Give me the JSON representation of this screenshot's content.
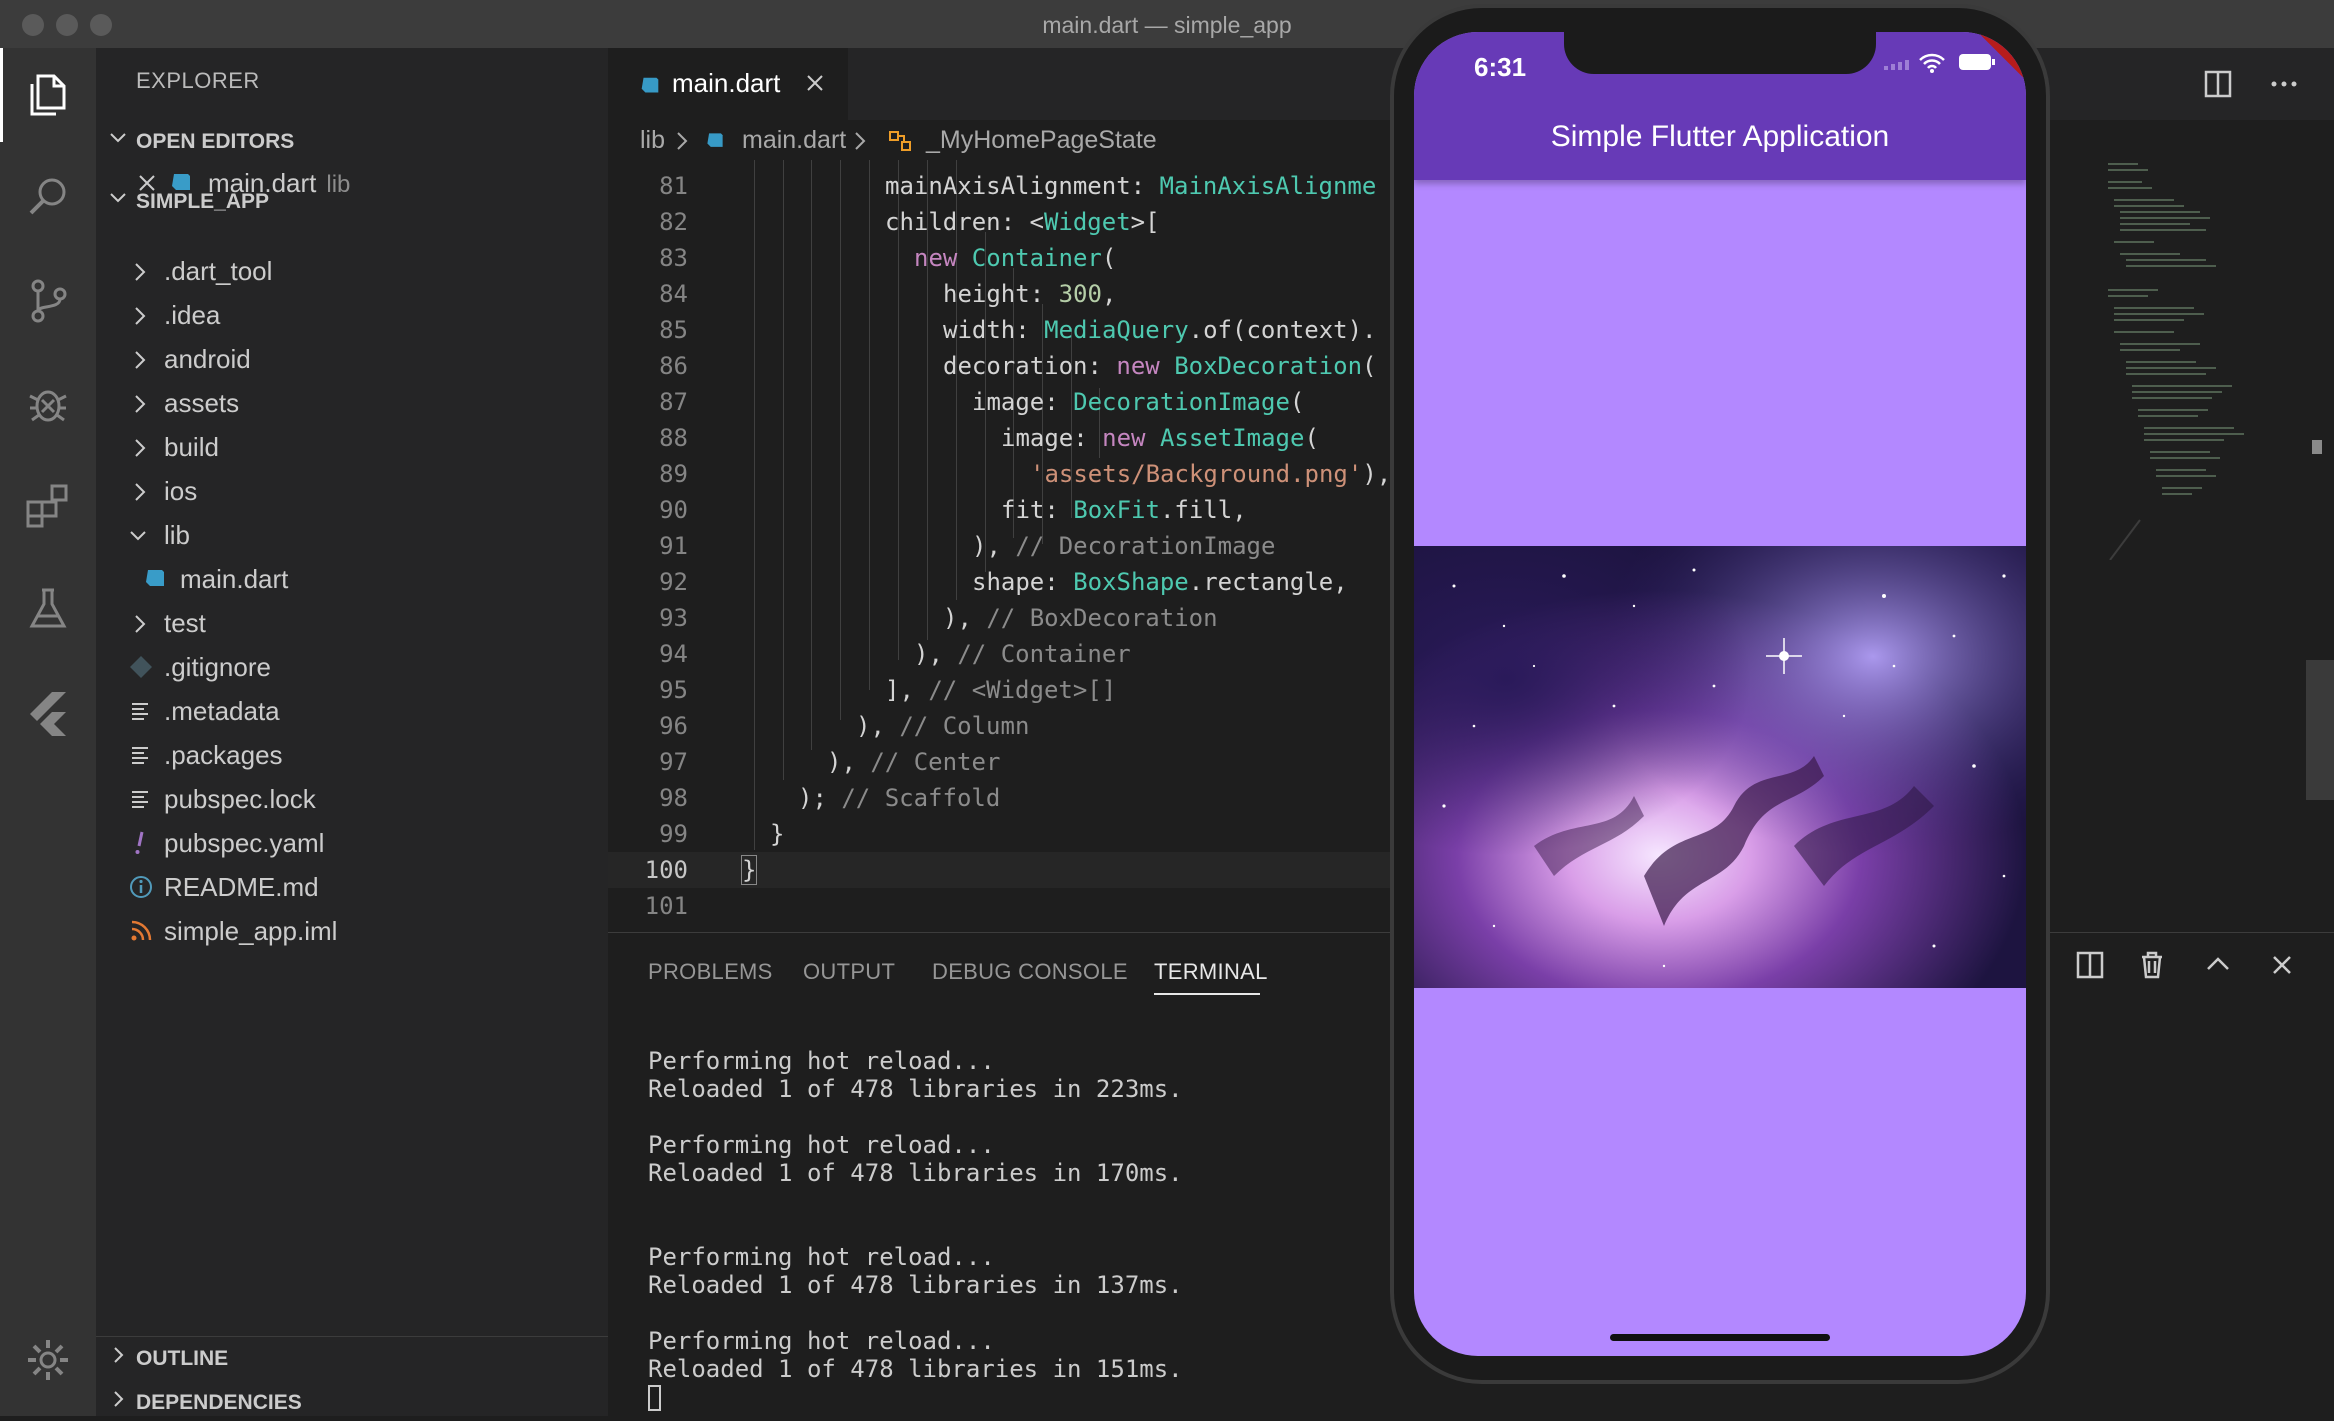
{
  "window": {
    "title": "main.dart — simple_app"
  },
  "sidebar": {
    "header": "EXPLORER",
    "open_editors": {
      "label": "OPEN EDITORS",
      "items": [
        {
          "name": "main.dart",
          "desc": "lib"
        }
      ]
    },
    "project": {
      "label": "SIMPLE_APP",
      "tree": [
        {
          "name": ".dart_tool"
        },
        {
          "name": ".idea"
        },
        {
          "name": "android"
        },
        {
          "name": "assets"
        },
        {
          "name": "build"
        },
        {
          "name": "ios"
        },
        {
          "name": "lib"
        },
        {
          "name": "main.dart"
        },
        {
          "name": "test"
        },
        {
          "name": ".gitignore"
        },
        {
          "name": ".metadata"
        },
        {
          "name": ".packages"
        },
        {
          "name": "pubspec.lock"
        },
        {
          "name": "pubspec.yaml"
        },
        {
          "name": "README.md"
        },
        {
          "name": "simple_app.iml"
        }
      ]
    },
    "outline_label": "OUTLINE",
    "dependencies_label": "DEPENDENCIES"
  },
  "editor": {
    "tab": {
      "name": "main.dart"
    },
    "breadcrumb": {
      "folder": "lib",
      "file": "main.dart",
      "symbol": "_MyHomePageState"
    },
    "line_numbers": [
      "81",
      "82",
      "83",
      "84",
      "85",
      "86",
      "87",
      "88",
      "89",
      "90",
      "91",
      "92",
      "93",
      "94",
      "95",
      "96",
      "97",
      "98",
      "99",
      "100",
      "101"
    ],
    "lines": {
      "l81_a": "mainAxisAlignment: ",
      "l81_b": "MainAxisAlignme",
      "l82_a": "children: <",
      "l82_b": "Widget",
      "l82_c": ">[",
      "l83_a": "new ",
      "l83_b": "Container",
      "l83_c": "(",
      "l84_a": "height: ",
      "l84_b": "300",
      "l84_c": ",",
      "l85_a": "width: ",
      "l85_b": "MediaQuery",
      "l85_c": ".of(context).",
      "l86_a": "decoration: ",
      "l86_b": "new ",
      "l86_c": "BoxDecoration",
      "l86_d": "(",
      "l87_a": "image: ",
      "l87_b": "DecorationImage",
      "l87_c": "(",
      "l88_a": "image: ",
      "l88_b": "new ",
      "l88_c": "AssetImage",
      "l88_d": "(",
      "l89_a": "'assets/Background.png'",
      "l89_b": "),",
      "l90_a": "fit: ",
      "l90_b": "BoxFit",
      "l90_c": ".fill,",
      "l91_a": "), ",
      "l91_b": "// DecorationImage",
      "l92_a": "shape: ",
      "l92_b": "BoxShape",
      "l92_c": ".rectangle,",
      "l93_a": "), ",
      "l93_b": "// BoxDecoration",
      "l94_a": "), ",
      "l94_b": "// Container",
      "l95_a": "], ",
      "l95_b": "// <Widget>[]",
      "l96_a": "), ",
      "l96_b": "// Column",
      "l97_a": "), ",
      "l97_b": "// Center",
      "l98_a": "); ",
      "l98_b": "// Scaffold",
      "l99": "}",
      "l100": "}"
    }
  },
  "panel": {
    "tabs": [
      "PROBLEMS",
      "OUTPUT",
      "DEBUG CONSOLE",
      "TERMINAL"
    ],
    "active_tab": "TERMINAL",
    "terminal": [
      "Performing hot reload...",
      "Reloaded 1 of 478 libraries in 223ms.",
      "Performing hot reload...",
      "Reloaded 1 of 478 libraries in 170ms.",
      "Performing hot reload...",
      "Reloaded 1 of 478 libraries in 137ms.",
      "Performing hot reload...",
      "Reloaded 1 of 478 libraries in 151ms."
    ]
  },
  "simulator": {
    "time": "6:31",
    "app_title": "Simple Flutter Application",
    "debug_banner": "DEBUG"
  },
  "colors": {
    "app_bar": "#673ab7",
    "body_background": "#b388ff",
    "debug_banner": "#b71c1c"
  }
}
